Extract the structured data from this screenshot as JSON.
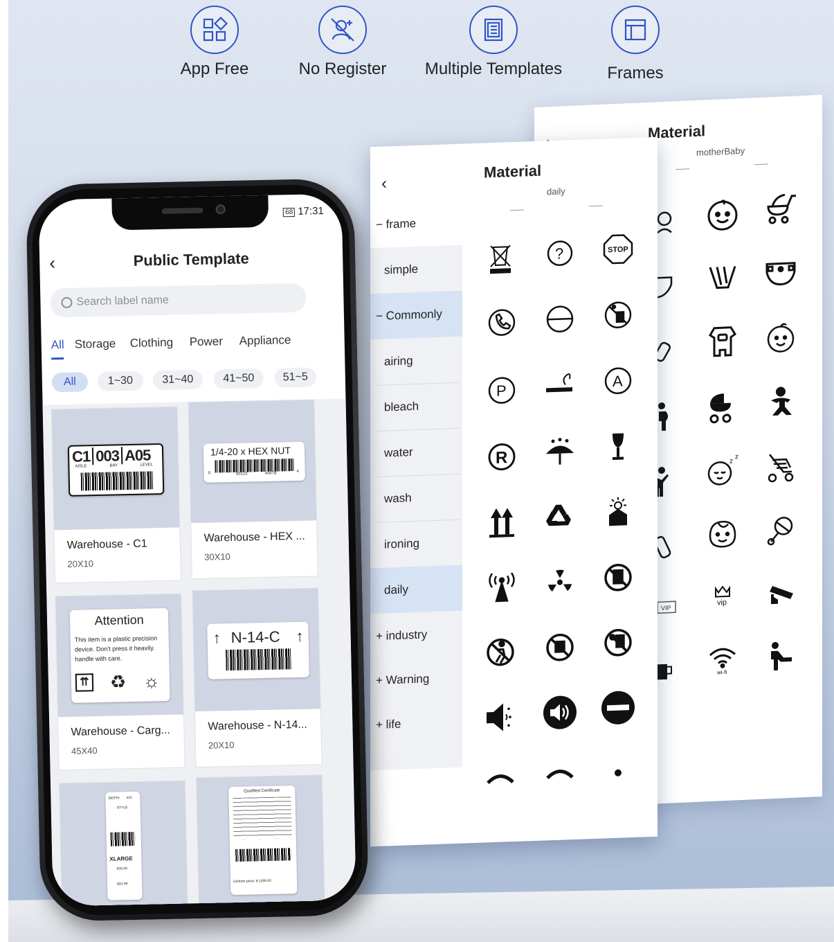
{
  "features": [
    {
      "label": "App Free",
      "icon": "grid-shapes-icon"
    },
    {
      "label": "No Register",
      "icon": "no-user-icon"
    },
    {
      "label": "Multiple Templates",
      "icon": "document-list-icon"
    },
    {
      "label": "Frames",
      "icon": "frame-layout-icon"
    }
  ],
  "back_panel": {
    "title": "Material",
    "subtitle": "motherBaby",
    "icons": [
      "baby-face-icon",
      "stroller-icon",
      "diaper-icon",
      "diaper-2-icon",
      "onesie-icon",
      "baby-smile-icon",
      "baby-carriage-icon",
      "baby-sitting-icon",
      "sleeping-baby-icon",
      "pushchair-icon",
      "baby-face-2-icon",
      "rattle-icon",
      "vip-crown-icon",
      "cctv-camera-icon",
      "wifi-icon",
      "baby-changing-icon"
    ],
    "vip_text": "vip",
    "wifi_text": "wi-fi",
    "vip_badge": "VIP"
  },
  "front_panel": {
    "title": "Material",
    "subtitle": "daily",
    "sidebar": [
      {
        "prefix": "−",
        "label": "frame"
      },
      {
        "prefix": "",
        "label": "simple"
      },
      {
        "prefix": "−",
        "label": "Commonly"
      },
      {
        "prefix": "",
        "label": "airing"
      },
      {
        "prefix": "",
        "label": "bleach"
      },
      {
        "prefix": "",
        "label": "water"
      },
      {
        "prefix": "",
        "label": "wash"
      },
      {
        "prefix": "",
        "label": "ironing"
      },
      {
        "prefix": "",
        "label": "daily"
      },
      {
        "prefix": "+",
        "label": "industry"
      },
      {
        "prefix": "+",
        "label": "Warning"
      },
      {
        "prefix": "+",
        "label": "life"
      }
    ],
    "stop_text": "STOP"
  },
  "phone": {
    "time": "17:31",
    "battery": "68",
    "title": "Public Template",
    "search_placeholder": "Search label name",
    "tabs": [
      "All",
      "Storage",
      "Clothing",
      "Power",
      "Appliance"
    ],
    "chips": [
      "All",
      "1~30",
      "31~40",
      "41~50",
      "51~5"
    ],
    "cards": [
      {
        "name": "Warehouse - C1",
        "size": "20X10"
      },
      {
        "name": "Warehouse - HEX ...",
        "size": "30X10"
      },
      {
        "name": "Warehouse - Carg...",
        "size": "45X40"
      },
      {
        "name": "Warehouse - N-14...",
        "size": "20X10"
      }
    ],
    "label_c1": {
      "a": "C1",
      "b": "003",
      "c": "A05",
      "aisle": "AISLE",
      "bay": "BAY",
      "level": "LEVEL"
    },
    "label_hex": {
      "text": "1/4-20 x HEX NUT",
      "n1": "0",
      "n2": "00123",
      "n3": "45678",
      "n4": "4"
    },
    "label_attention": {
      "title": "Attention",
      "body": "This item is a plastic precision device. Don't press it heavily. handle with care."
    },
    "label_n14": {
      "text": "N-14-C"
    },
    "label_tag": {
      "dept": "DEPT#",
      "num": "415",
      "style": "STYLE",
      "size": "XLARGE",
      "price1": "$35.00",
      "price2": "$24.99"
    },
    "label_cert": {
      "title": "Qualified Certificate",
      "price": "Uniform price: $ 1299.00"
    }
  }
}
